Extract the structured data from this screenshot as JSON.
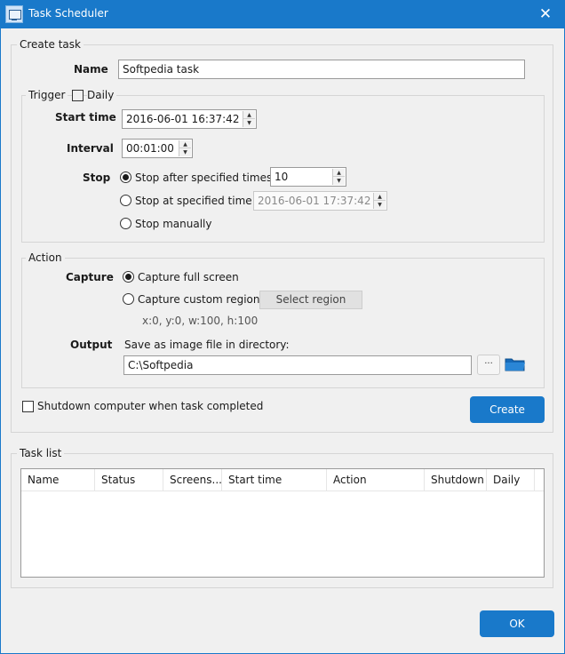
{
  "window": {
    "title": "Task Scheduler",
    "close_glyph": "✕"
  },
  "create_task": {
    "legend": "Create task",
    "name_label": "Name",
    "name_value": "Softpedia task",
    "trigger": {
      "legend": "Trigger",
      "daily_label": "Daily",
      "daily_checked": false,
      "start_time_label": "Start time",
      "start_time_value": "2016-06-01 16:37:42",
      "interval_label": "Interval",
      "interval_value": "00:01:00",
      "stop_label": "Stop",
      "stop_options": [
        {
          "label": "Stop after specified times:",
          "checked": true
        },
        {
          "label": "Stop at specified time:",
          "checked": false
        },
        {
          "label": "Stop manually",
          "checked": false
        }
      ],
      "stop_times_value": "10",
      "stop_time_value": "2016-06-01 17:37:42"
    },
    "action": {
      "legend": "Action",
      "capture_label": "Capture",
      "capture_options": [
        {
          "label": "Capture full screen",
          "checked": true
        },
        {
          "label": "Capture custom region",
          "checked": false
        }
      ],
      "select_region_label": "Select region",
      "region_info": "x:0, y:0, w:100, h:100",
      "output_label": "Output",
      "output_desc": "Save as image file in directory:",
      "output_dir": "C:\\Softpedia",
      "browse_label": "···"
    },
    "shutdown_label": "Shutdown computer when task completed",
    "shutdown_checked": false,
    "create_button": "Create"
  },
  "task_list": {
    "legend": "Task list",
    "columns": [
      "Name",
      "Status",
      "Screens...",
      "Start time",
      "Action",
      "Shutdown",
      "Daily"
    ],
    "rows": []
  },
  "ok_button": "OK",
  "icons": {
    "app": "task-scheduler-icon",
    "close": "close-icon",
    "spin_up": "▲",
    "spin_down": "▼",
    "folder": "folder-icon"
  },
  "colors": {
    "accent": "#1979ca",
    "folder": "#1669b8"
  }
}
